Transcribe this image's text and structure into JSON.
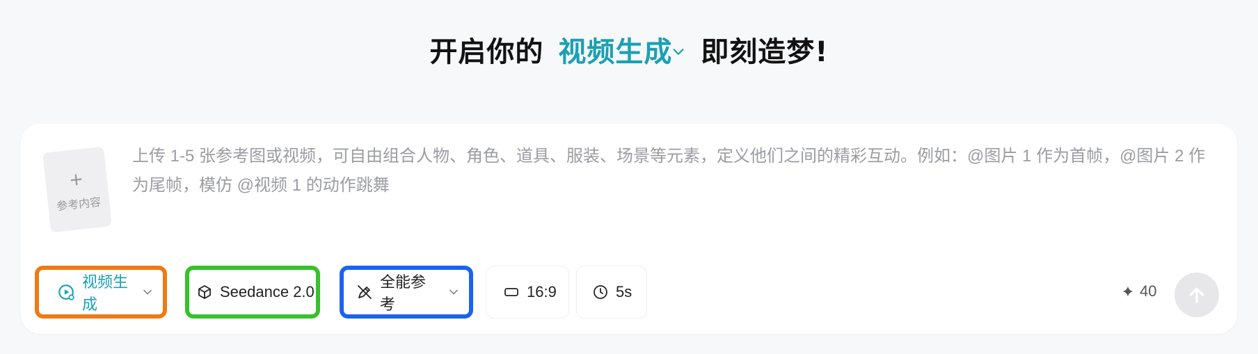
{
  "header": {
    "prefix": "开启你的",
    "mode": "视频生成",
    "suffix": "即刻造梦!",
    "accent_color": "#1aa0b4"
  },
  "reference_upload": {
    "plus": "+",
    "label": "参考内容"
  },
  "prompt": {
    "placeholder": "上传 1-5 张参考图或视频，可自由组合人物、角色、道具、服装、场景等元素，定义他们之间的精彩互动。例如：@图片 1 作为首帧，@图片 2 作为尾帧，模仿 @视频 1 的动作跳舞"
  },
  "toolbar": {
    "mode_label": "视频生成",
    "model_label": "Seedance 2.0",
    "reference_label": "全能参考",
    "ratio_label": "16:9",
    "duration_label": "5s",
    "credits": "40",
    "highlight_colors": {
      "mode": "#f07a12",
      "model": "#36c22b",
      "reference": "#1a62f0"
    },
    "icons": {
      "mode": "video-play-circle-icon",
      "model": "cube-icon",
      "reference": "pen-tool-icon",
      "ratio": "aspect-ratio-icon",
      "duration": "clock-icon",
      "credits": "sparkle-icon",
      "send": "arrow-up-icon"
    }
  }
}
